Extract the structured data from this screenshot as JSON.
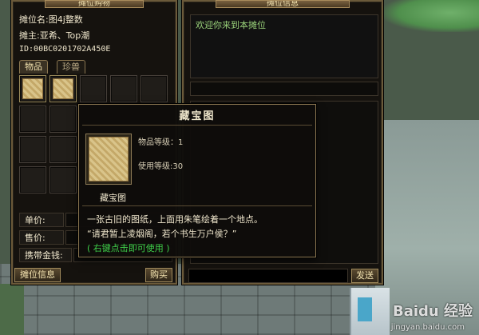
{
  "left_panel": {
    "title": "摊位购物",
    "stall_name": "摊位名:图4j整数",
    "stall_owner": "摊主:亚希、Top潮",
    "stall_id": "ID:00BC0201702A450E",
    "tabs": [
      {
        "label": "物品"
      },
      {
        "label": "珍兽"
      }
    ],
    "unit_price_label": "单价:",
    "sale_price_label": "售价:",
    "money_label": "携带金钱:",
    "stall_info_button": "摊位信息",
    "buy_button": "购买"
  },
  "right_panel": {
    "title": "摊位信息",
    "welcome_text": "欢迎你来到本摊位",
    "send_button": "发送"
  },
  "tooltip": {
    "title": "藏宝图",
    "item_level": "物品等级：1",
    "use_level": "使用等级:30",
    "item_name": "藏宝图",
    "desc_line1": "一张古旧的图纸，上面用朱笔绘着一个地点。",
    "desc_line2": "“请君暂上凌烟阁，若个书生万户侯？”",
    "hint": "( 右键点击即可使用 )"
  },
  "watermark": {
    "brand": "Baidu 经验",
    "url": "jingyan.baidu.com"
  }
}
